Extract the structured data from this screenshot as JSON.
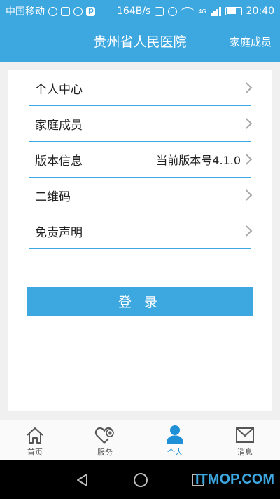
{
  "status_bar": {
    "carrier": "中国移动",
    "speed": "164B/s",
    "network": "4G",
    "time": "20:40",
    "battery_level": 0.7,
    "icons": [
      "cloud-icon",
      "image-icon",
      "circle-icon",
      "p-icon",
      "bell-icon",
      "alarm-icon",
      "wifi-icon",
      "signal-icon",
      "battery-icon"
    ]
  },
  "header": {
    "title": "贵州省人民医院",
    "action": "家庭成员"
  },
  "menu": {
    "items": [
      {
        "label": "个人中心",
        "value": ""
      },
      {
        "label": "家庭成员",
        "value": ""
      },
      {
        "label": "版本信息",
        "value": "当前版本号4.1.0"
      },
      {
        "label": "二维码",
        "value": ""
      },
      {
        "label": "免责声明",
        "value": ""
      }
    ]
  },
  "login": {
    "label": "登 录"
  },
  "tabbar": {
    "tabs": [
      {
        "label": "首页",
        "icon": "home-icon"
      },
      {
        "label": "服务",
        "icon": "heart-plus-icon"
      },
      {
        "label": "个人",
        "icon": "person-icon",
        "active": true
      },
      {
        "label": "消息",
        "icon": "mail-icon"
      }
    ]
  },
  "watermark": "ITMOP.COM",
  "colors": {
    "accent": "#3da7df",
    "active_tab": "#1f8fd6"
  }
}
